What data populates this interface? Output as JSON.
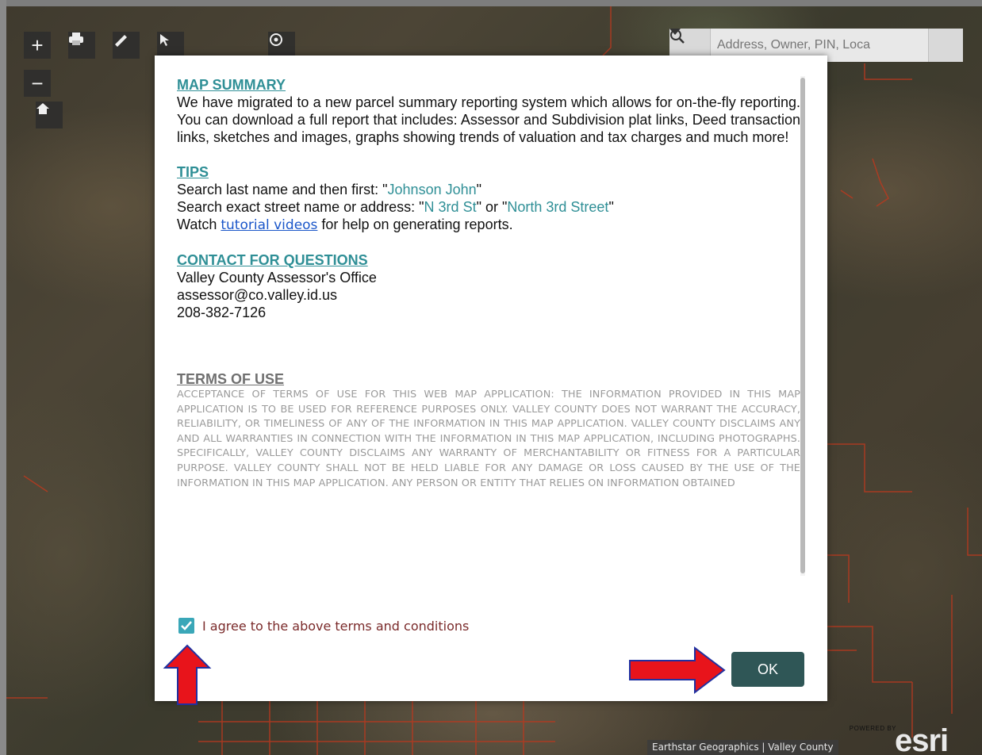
{
  "toolbar": {
    "zoom_in": "+",
    "zoom_out": "−",
    "tools": [
      "print-icon",
      "measure-icon",
      "select-icon",
      "basemap-icon"
    ],
    "home": "home-icon"
  },
  "search": {
    "placeholder": "Address, Owner, PIN, Loca",
    "dropdown_icon": "caret-down-icon",
    "button_icon": "search-icon"
  },
  "dialog": {
    "summary_heading": "MAP SUMMARY",
    "summary_text": "We have migrated to a new parcel summary reporting system which allows for on-the-fly reporting. You can download a full report that includes: Assessor and Subdivision plat links, Deed transaction links, sketches and images, graphs showing trends of valuation and tax charges and much more!",
    "tips_heading": "TIPS",
    "tip1_prefix": "Search last name and then first: \"",
    "tip1_example": "Johnson John",
    "tip1_suffix": "\"",
    "tip2_prefix": "Search exact street name or address: \"",
    "tip2_example1": "N 3rd St",
    "tip2_mid": "\" or \"",
    "tip2_example2": "North 3rd Street",
    "tip2_suffix": "\"",
    "tip3_prefix": "Watch ",
    "tip3_link": "tutorial videos",
    "tip3_suffix": " for help on generating reports.",
    "contact_heading": "CONTACT FOR QUESTIONS",
    "contact_office": "Valley County Assessor's Office",
    "contact_email": "assessor@co.valley.id.us",
    "contact_phone": "208-382-7126",
    "terms_heading": "TERMS OF USE",
    "terms_text": "ACCEPTANCE OF TERMS OF USE FOR THIS WEB MAP APPLICATION: THE INFORMATION PROVIDED IN THIS MAP APPLICATION IS TO BE USED FOR REFERENCE PURPOSES ONLY. VALLEY COUNTY DOES NOT WARRANT THE ACCURACY, RELIABILITY, OR TIMELINESS OF ANY OF THE INFORMATION IN THIS MAP APPLICATION. VALLEY COUNTY DISCLAIMS ANY AND ALL WARRANTIES IN CONNECTION WITH THE INFORMATION IN THIS MAP APPLICATION, INCLUDING PHOTOGRAPHS. SPECIFICALLY, VALLEY COUNTY DISCLAIMS ANY WARRANTY OF MERCHANTABILITY OR FITNESS FOR A PARTICULAR PURPOSE. VALLEY COUNTY SHALL NOT BE HELD LIABLE FOR ANY DAMAGE OR LOSS CAUSED BY THE USE OF THE INFORMATION IN THIS MAP APPLICATION. ANY PERSON OR ENTITY THAT RELIES ON INFORMATION OBTAINED",
    "agree_label": "I agree to the above terms and conditions",
    "agree_checked": true,
    "ok_label": "OK"
  },
  "attribution": "Earthstar Geographics | Valley County",
  "esri": {
    "powered": "POWERED BY",
    "wordmark": "esri"
  },
  "colors": {
    "heading_teal": "#2f8f96",
    "ok_button": "#2f5656",
    "checkbox": "#3aa7b8",
    "annotation_arrow": "#e8141b",
    "parcel_lines": "#b9391f"
  }
}
